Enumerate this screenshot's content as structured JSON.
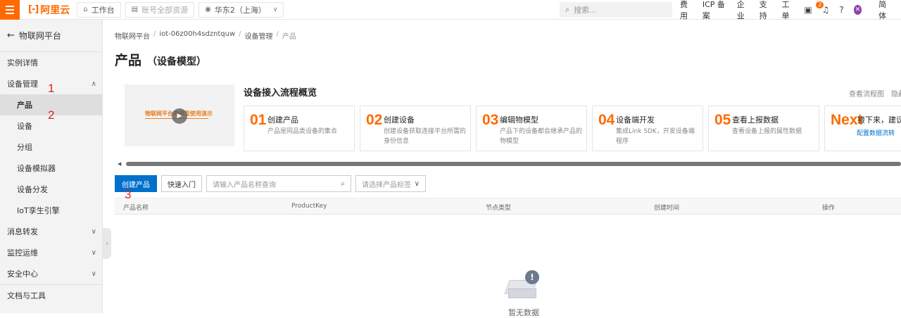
{
  "topbar": {
    "logo_mark": "[-]",
    "logo_name": "阿里云",
    "workbench": "工作台",
    "resource_group": "账号全部资源",
    "region": "华东2（上海）",
    "search_placeholder": "搜索...",
    "links": [
      "费用",
      "ICP 备案",
      "企业",
      "支持",
      "工单"
    ],
    "notification_count": "2",
    "language": "简体"
  },
  "sidebar": {
    "back_label": "物联网平台",
    "items": [
      {
        "label": "实例详情"
      },
      {
        "label": "设备管理"
      },
      {
        "label": "产品"
      },
      {
        "label": "设备"
      },
      {
        "label": "分组"
      },
      {
        "label": "设备模拟器"
      },
      {
        "label": "设备分发"
      },
      {
        "label": "IoT孪生引擎"
      },
      {
        "label": "消息转发"
      },
      {
        "label": "监控运维"
      },
      {
        "label": "安全中心"
      },
      {
        "label": "文档与工具"
      }
    ]
  },
  "breadcrumb": [
    "物联网平台",
    "iot-06z00h4sdzntquw",
    "设备管理",
    "产品"
  ],
  "page": {
    "title": "产品",
    "subtitle": "（设备模型）"
  },
  "overview": {
    "video_caption": "物联网平台物模型使用演示",
    "title": "设备接入流程概览",
    "links": [
      "查看流程图",
      "隐藏"
    ],
    "steps": [
      {
        "num": "01",
        "title": "创建产品",
        "desc": "产品是同品类设备的集合"
      },
      {
        "num": "02",
        "title": "创建设备",
        "desc": "创建设备获取连接平台所需的身份信息"
      },
      {
        "num": "03",
        "title": "编辑物模型",
        "desc": "产品下的设备都会继承产品的物模型"
      },
      {
        "num": "04",
        "title": "设备端开发",
        "desc": "集成Link SDK，开发设备端程序"
      },
      {
        "num": "05",
        "title": "查看上报数据",
        "desc": "查看设备上报的属性数据"
      }
    ],
    "next": {
      "num": "Next",
      "title": "接下来，建议您",
      "link": "配置数据流转"
    }
  },
  "toolbar": {
    "create_label": "创建产品",
    "quickstart_label": "快速入门",
    "search_placeholder": "请输入产品名称查询",
    "tag_placeholder": "请选择产品标签"
  },
  "table": {
    "columns": [
      "产品名称",
      "ProductKey",
      "节点类型",
      "创建时间",
      "操作"
    ]
  },
  "empty_text": "暂无数据",
  "annotations": [
    "1",
    "2",
    "3"
  ],
  "colors": {
    "brand": "#ff6a00",
    "primary": "#0070cc",
    "annotation": "#e02020"
  }
}
